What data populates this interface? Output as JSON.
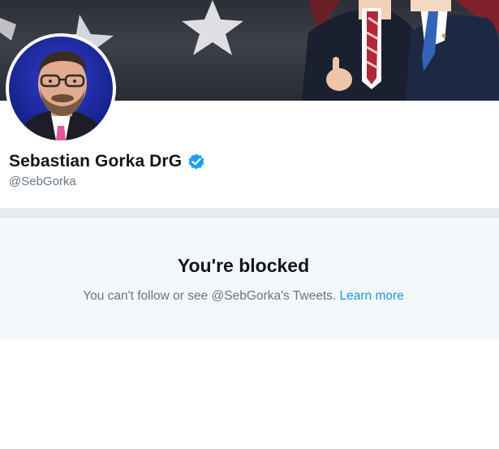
{
  "profile": {
    "name": "Sebastian Gorka DrG",
    "handle": "@SebGorka",
    "verified_icon": "verified-badge-icon"
  },
  "blocked": {
    "title": "You're blocked",
    "message": "You can't follow or see @SebGorka's Tweets.",
    "learn_more": "Learn more"
  },
  "colors": {
    "link": "#1b95e0",
    "name_text": "#14171a",
    "secondary_text": "#657786",
    "panel_bg": "#f5f8fa",
    "verified": "#1da1f2"
  }
}
